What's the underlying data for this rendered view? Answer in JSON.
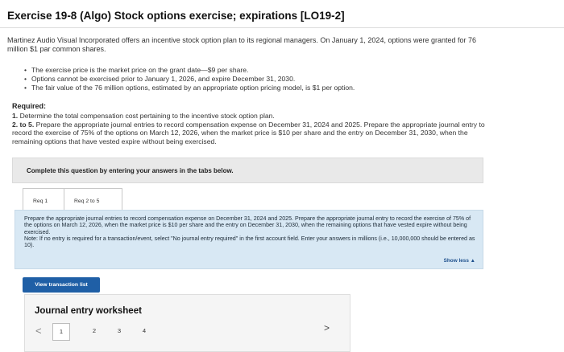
{
  "header": {
    "title": "Exercise 19-8 (Algo) Stock options exercise; expirations [LO19-2]"
  },
  "intro": "Martinez Audio Visual Incorporated offers an incentive stock option plan to its regional managers. On January 1, 2024, options were granted for 76 million $1 par common shares.",
  "bullets": [
    "The exercise price is the market price on the grant date—$9 per share.",
    "Options cannot be exercised prior to January 1, 2026, and expire December 31, 2030.",
    "The fair value of the 76 million options, estimated by an appropriate option pricing model, is $1 per option."
  ],
  "required": {
    "heading": "Required:",
    "items": [
      {
        "num": "1.",
        "text": "Determine the total compensation cost pertaining to the incentive stock option plan."
      },
      {
        "num": "2. to 5.",
        "text": "Prepare the appropriate journal entries to record compensation expense on December 31, 2024 and 2025. Prepare the appropriate journal entry to record the exercise of 75% of the options on March 12, 2026, when the market price is $10 per share and the entry on December 31, 2030, when the remaining options that have vested expire without being exercised."
      }
    ]
  },
  "banner": "Complete this question by entering your answers in the tabs below.",
  "tabs": [
    {
      "label": "Req 1"
    },
    {
      "label": "Req 2 to 5"
    }
  ],
  "panel": {
    "instructions": "Prepare the appropriate journal entries to record compensation expense on December 31, 2024 and 2025. Prepare the appropriate journal entry to record the exercise of 75% of the options on March 12, 2026, when the market price is $10 per share and the entry on December 31, 2030, when the remaining options that have vested expire without being exercised.",
    "note": "Note: If no entry is required for a transaction/event, select \"No journal entry required\" in the first account field. Enter your answers in millions (i.e., 10,000,000 should be entered as 10).",
    "show_less": "Show less ▲"
  },
  "buttons": {
    "view_transaction_list": "View transaction list"
  },
  "worksheet": {
    "title": "Journal entry worksheet",
    "prev_icon": "chevron-left-icon",
    "next_icon": "chevron-right-icon",
    "prev_glyph": "<",
    "next_glyph": ">",
    "pages": [
      "1",
      "2",
      "3",
      "4"
    ]
  }
}
